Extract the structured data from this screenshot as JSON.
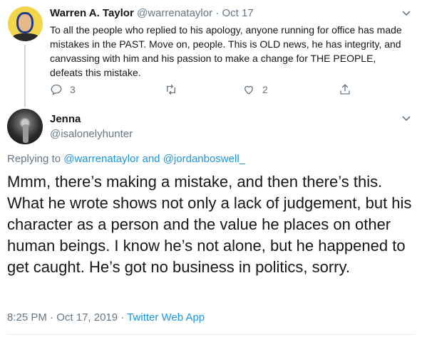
{
  "parent_tweet": {
    "author_name": "Warren A. Taylor",
    "author_handle": "@warrenataylor",
    "separator": "·",
    "date": "Oct 17",
    "text": "To all the people who replied to his apology, anyone running for office has made mistakes in the PAST. Move on, people. This is OLD news, he has integrity, and canvassing with him and his passion to make a change for THE PEOPLE, defeats this mistake.",
    "actions": {
      "reply_count": "3",
      "retweet_count": "",
      "like_count": "2"
    }
  },
  "reply_tweet": {
    "author_name": "Jenna",
    "author_handle": "@isalonelyhunter",
    "replying_prefix": "Replying to",
    "replying_user1": "@warrenataylor",
    "replying_and": "and",
    "replying_user2": "@jordanboswell_",
    "text": "Mmm, there’s making a mistake, and then there’s this. What he wrote shows not only a lack of judgement, but his character as a person and the value he places on other human beings. I know he’s not alone, but he happened to get caught. He’s got no business in politics, sorry.",
    "time": "8:25 PM",
    "meta_sep": "·",
    "date": "Oct 17, 2019",
    "meta_sep2": "·",
    "source": "Twitter Web App"
  },
  "colors": {
    "text": "#14171a",
    "muted": "#657786",
    "link": "#1b95e0",
    "thread_line": "#ccd6dd"
  },
  "icons": [
    "chevron-down-icon",
    "reply-icon",
    "retweet-icon",
    "like-icon",
    "share-icon"
  ]
}
